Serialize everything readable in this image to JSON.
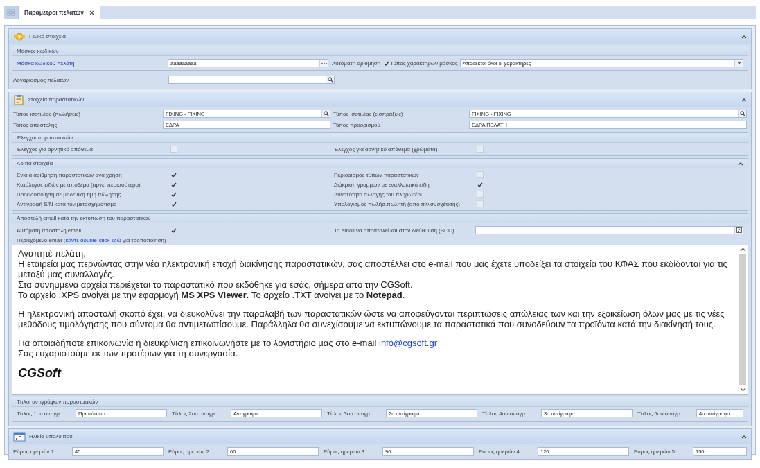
{
  "tabs": [
    {
      "label": "Παράμετροι πελατών",
      "selected": true
    }
  ],
  "general": {
    "title": "Γενικά στοιχεία",
    "expanded": true,
    "masks": {
      "title": "Μάσκες κωδικών",
      "customer_mask": {
        "label": "Μάσκα κωδικού πελάτη",
        "value": "aaaaaaaaa"
      },
      "auto_numbering": {
        "label": "Αυτόματη αρίθμηση",
        "checked": true
      },
      "char_type": {
        "label": "Τύπος χαρακτήρων μάσκας",
        "value": "Αποδεκτοί όλοι οι χαρακτήρες"
      }
    },
    "accounts": {
      "label": "Λογαριασμός πελατών"
    }
  },
  "documents": {
    "title": "Στοιχεία παραστατικών",
    "expanded": true,
    "fields": [
      {
        "label": "Τύπος ισοτιμίας (πωλήσεις)",
        "value": "FIXING - FIXING",
        "kind": "lookup"
      },
      {
        "label": "Τύπος ισοτιμίας (εισπράξεις)",
        "value": "FIXING - FIXING",
        "kind": "lookup"
      },
      {
        "label": "Τόπος αποστολής",
        "value": "ΕΔΡΑ",
        "kind": "text"
      },
      {
        "label": "Τόπος προορισμού",
        "value": "ΕΔΡΑ ΠΕΛΑΤΗ",
        "kind": "text"
      }
    ],
    "checks": {
      "title": "Έλεγχοι παραστατικών",
      "items": [
        {
          "label": "Έλεγχος για αρνητικό απόθεμα",
          "checked": false
        },
        {
          "label": "Έλεγχος για αρνητικό απόθεμα (χρώματα)",
          "checked": false
        }
      ]
    },
    "other": {
      "title": "Λοιπά στοιχεία",
      "expanded": true,
      "items": [
        {
          "label": "Ενιαία αρίθμηση παραστατικών ανά χρήση",
          "checked": true
        },
        {
          "label": "Περιορισμός τύπων παραστατικών",
          "checked": false
        },
        {
          "label": "Κατάλογος ειδών με απόθεμα (αργεί περισσότερο)",
          "checked": true
        },
        {
          "label": "Διάκριση γραμμών με εναλλακτικά είδη",
          "checked": true
        },
        {
          "label": "Προειδοποίηση σε μηδενική τιμή πώλησης",
          "checked": true
        },
        {
          "label": "Δυνατότητα αλλαγής του πληρωτέου",
          "checked": false
        },
        {
          "label": "Αντιγραφή S/N κατά τον μετασχηματισμό",
          "checked": true
        },
        {
          "label": "Υπολογισμός πωλήσ.πωλητή (από πίν.συσχέτισης)",
          "checked": false
        }
      ]
    },
    "email": {
      "title": "Αποστολή email κατά την εκτύπωση του παραστατικού",
      "auto_send": {
        "label": "Αυτόματη αποστολή email",
        "checked": true
      },
      "bcc": {
        "label": "Το email να αποστολεί και στην διεύθυνση (BCC)"
      },
      "content_note": {
        "before": "Περιεχόμενο email (",
        "link": "κάντε double-click εδώ",
        "after": " για τροποποίηση)"
      },
      "body": [
        {
          "lines": [
            {
              "text": "Αγαπητέ πελάτη,"
            },
            {
              "text": "Η εταιρεία μας περνώντας στην νέα ηλεκτρονική εποχή διακίνησης παραστατικών, σας αποστέλλει στο e-mail που μας έχετε υποδείξει τα στοιχεία του ΚΦΑΣ που εκδίδονται για τις μεταξύ μας συναλλαγές."
            },
            {
              "text": "Στα συνημμένα αρχεία περιέχεται το παραστατικό που εκδόθηκε για εσάς, σήμερα από την CGSoft."
            },
            {
              "text": "Το αρχείο .XPS ανοίγει με την εφαρμογή **MS XPS Viewer**. Το αρχείο .TXT ανοίγει με το **Notepad**."
            }
          ]
        },
        {
          "lines": [
            {
              "text": "Η ηλεκτρονική αποστολή σκοπό έχει, να διευκολύνει την παραλαβή των παραστατικών ώστε να αποφεύγονται περιπτώσεις απώλειας των και την εξοικείωση όλων μας με τις νέες μεθόδους τιμολόγησης που σύντομα θα αντιμετωπίσουμε. Παράλληλα θα συνεχίσουμε να εκτυπώνουμε τα παραστατικά που συνοδεύουν τα προϊόντα κατά την διακίνησή τους."
            }
          ]
        },
        {
          "lines": [
            {
              "text": "Για οποιαδήποτε επικοινωνία ή διευκρίνιση επικοινωνήστε με το λογιστήριο μας στο e-mail ",
              "link": "info@cgsoft.gr"
            },
            {
              "text": "Σας ευχαριστούμε εκ των προτέρων για τη συνεργασία."
            }
          ]
        }
      ],
      "signature": "CGSoft"
    }
  },
  "copy_titles": {
    "title": "Τίτλοι αντιγράφων παραστατικών",
    "items": [
      {
        "label": "Τίτλος 1ου αντιγρ.",
        "value": "Πρωτότυπο"
      },
      {
        "label": "Τίτλος 2ου αντιγρ.",
        "value": "Αντίγραφο"
      },
      {
        "label": "Τίτλος 3ου αντιγρ.",
        "value": "2ο αντίγραφο"
      },
      {
        "label": "Τίτλος 4ου αντιγρ.",
        "value": "3ο αντίγραφο"
      },
      {
        "label": "Τίτλος 5ου αντιγρ.",
        "value": "4ο αντίγραφο"
      }
    ]
  },
  "aging": {
    "title": "Ηλικία υπολοίπου",
    "expanded": true,
    "items": [
      {
        "label": "Εύρος ημερών 1",
        "value": "45"
      },
      {
        "label": "Εύρος ημερών 2",
        "value": "60"
      },
      {
        "label": "Εύρος ημερών 3",
        "value": "90"
      },
      {
        "label": "Εύρος ημερών 4",
        "value": "120"
      },
      {
        "label": "Εύρος ημερών 5",
        "value": "150"
      }
    ]
  }
}
